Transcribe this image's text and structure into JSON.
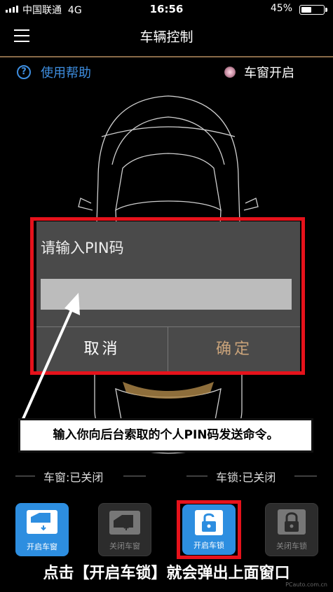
{
  "status_bar": {
    "carrier": "中国联通",
    "network": "4G",
    "time": "16:56",
    "battery_pct": "45%"
  },
  "header": {
    "title": "车辆控制"
  },
  "top": {
    "help_label": "使用帮助",
    "window_status": "车窗开启"
  },
  "dialog": {
    "prompt": "请输入PIN码",
    "input_value": "",
    "cancel_label": "取消",
    "confirm_label": "确定"
  },
  "annotations": {
    "instruction": "输入你向后台索取的个人PIN码发送命令。",
    "bottom_caption": "点击【开启车锁】就会弹出上面窗口"
  },
  "status_labels": {
    "window": "车窗:已关闭",
    "lock": "车锁:已关闭"
  },
  "controls": [
    {
      "label": "开启车窗",
      "icon": "window-open-icon",
      "active": true
    },
    {
      "label": "关闭车窗",
      "icon": "window-close-icon",
      "active": false
    },
    {
      "label": "开启车锁",
      "icon": "unlock-icon",
      "active": true
    },
    {
      "label": "关闭车锁",
      "icon": "lock-icon",
      "active": false
    }
  ],
  "colors": {
    "accent_blue": "#2d8ee0",
    "highlight_red": "#e6121b",
    "confirm_gold": "#c9a37a"
  },
  "watermark": "PCauto.com.cn"
}
